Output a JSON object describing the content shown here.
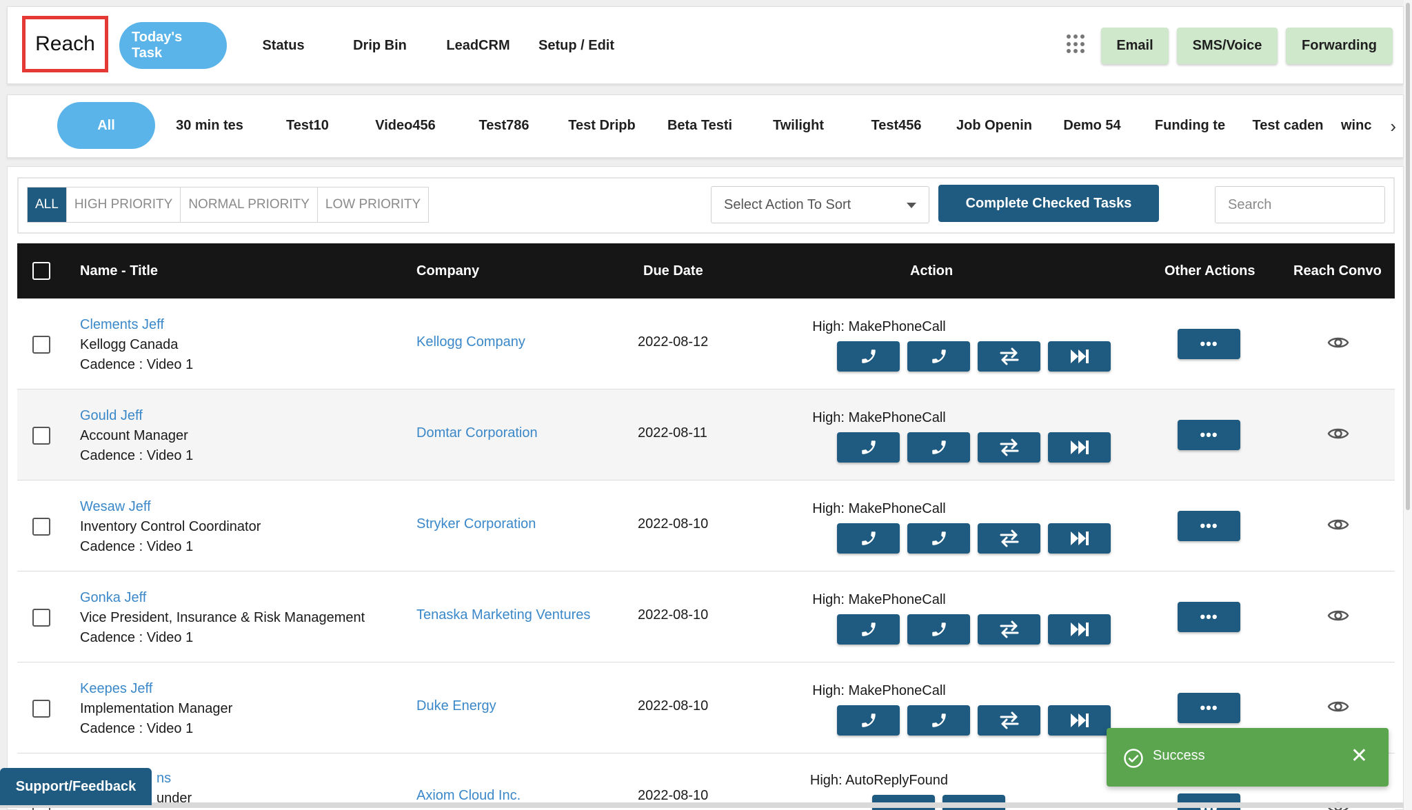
{
  "header": {
    "logo_text": "Reach",
    "nav": [
      "Today's Task",
      "Status",
      "Drip Bin",
      "LeadCRM",
      "Setup / Edit"
    ],
    "buttons": [
      "Email",
      "SMS/Voice",
      "Forwarding"
    ]
  },
  "cadence_tabs": [
    "All",
    "30 min tes",
    "Test10",
    "Video456",
    "Test786",
    "Test Dripb",
    "Beta Testi",
    "Twilight",
    "Test456",
    "Job Openin",
    "Demo 54",
    "Funding te",
    "Test caden",
    "winc"
  ],
  "filters": {
    "priorities": [
      "ALL",
      "HIGH PRIORITY",
      "NORMAL PRIORITY",
      "LOW PRIORITY"
    ],
    "sort_placeholder": "Select Action To Sort",
    "complete_label": "Complete Checked Tasks",
    "search_placeholder": "Search"
  },
  "table": {
    "columns": [
      "Name - Title",
      "Company",
      "Due Date",
      "Action",
      "Other Actions",
      "Reach Convo"
    ],
    "rows": [
      {
        "name": "Clements Jeff",
        "title": "Kellogg Canada",
        "cadence": "Cadence : Video 1",
        "company": "Kellogg Company",
        "due": "2022-08-12",
        "action": "High: MakePhoneCall"
      },
      {
        "name": "Gould Jeff",
        "title": "Account Manager",
        "cadence": "Cadence : Video 1",
        "company": "Domtar Corporation",
        "due": "2022-08-11",
        "action": "High: MakePhoneCall"
      },
      {
        "name": "Wesaw Jeff",
        "title": "Inventory Control Coordinator",
        "cadence": "Cadence : Video 1",
        "company": "Stryker Corporation",
        "due": "2022-08-10",
        "action": "High: MakePhoneCall"
      },
      {
        "name": "Gonka Jeff",
        "title": "Vice President, Insurance & Risk Management",
        "cadence": "Cadence : Video 1",
        "company": "Tenaska Marketing Ventures",
        "due": "2022-08-10",
        "action": "High: MakePhoneCall"
      },
      {
        "name": "Keepes Jeff",
        "title": "Implementation Manager",
        "cadence": "Cadence : Video 1",
        "company": "Duke Energy",
        "due": "2022-08-10",
        "action": "High: MakePhoneCall"
      },
      {
        "name": "ns",
        "title": "under",
        "cadence": "",
        "company": "Axiom Cloud Inc.",
        "due": "2022-08-10",
        "action": "High: AutoReplyFound"
      }
    ],
    "more_label": "•••"
  },
  "support_label": "Support/Feedback",
  "toast": {
    "message": "Success",
    "close": "✕"
  },
  "icons": {
    "phone": "phone-icon",
    "swap": "swap-icon",
    "skip": "skip-forward-icon",
    "eye": "eye-icon",
    "check": "check-circle-icon",
    "apps": "apps-grid-icon"
  },
  "colors": {
    "primary": "#1f5b80",
    "accent": "#5ab4e9",
    "success": "#5aa54e",
    "link": "#3a88c9",
    "green_btn": "#cfe8cb"
  }
}
